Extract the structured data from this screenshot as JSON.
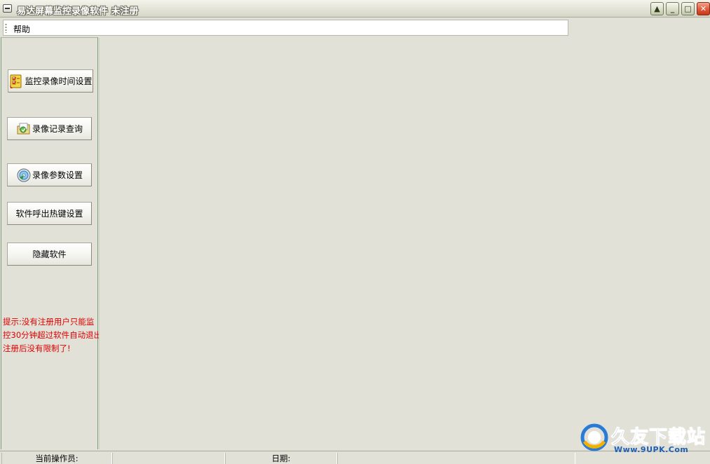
{
  "window": {
    "title": "易达屏幕监控录像软件 未注册",
    "buttons": {
      "restore_glyph": "▲",
      "minimize_glyph": "_",
      "maximize_glyph": "□",
      "close_glyph": "✕"
    }
  },
  "menu": {
    "items": [
      {
        "label": "帮助"
      }
    ]
  },
  "sidebar": {
    "buttons": [
      {
        "label": "监控录像时间设置",
        "icon": "schedule-icon"
      },
      {
        "label": "录像记录查询",
        "icon": "folder-search-icon"
      },
      {
        "label": "录像参数设置",
        "icon": "settings-disc-icon"
      },
      {
        "label": "软件呼出热键设置",
        "icon": ""
      },
      {
        "label": "隐藏软件",
        "icon": ""
      }
    ],
    "hint_lines": [
      "提示:没有注册用户只能监",
      "控30分钟超过软件自动退出",
      "注册后没有限制了!"
    ],
    "hint_color": "#e00000"
  },
  "statusbar": {
    "operator_label": "当前操作员:",
    "operator_value": "",
    "date_label": "日期:",
    "date_value": ""
  },
  "watermark": {
    "text": "久友下载站",
    "url": "Www.9UPK.Com",
    "color": "#1d5fb8"
  }
}
